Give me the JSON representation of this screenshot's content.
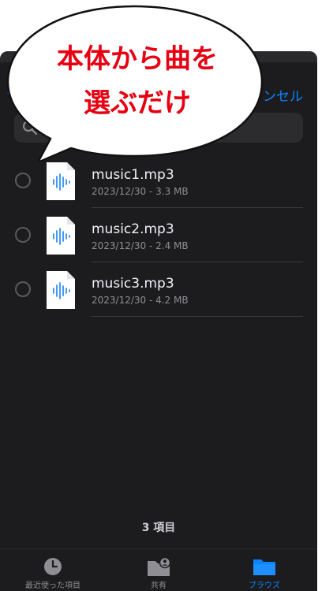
{
  "callout": {
    "line1": "本体から曲を",
    "line2": "選ぶだけ",
    "text_color": "#e60012"
  },
  "header": {
    "back_icon": "chevron-left-icon",
    "cancel_label": "ンセル"
  },
  "search": {
    "icon": "magnifying-glass-icon",
    "placeholder": ""
  },
  "files": [
    {
      "name": "music1.mp3",
      "meta": "2023/12/30 - 3.3 MB",
      "icon": "audio-file-icon"
    },
    {
      "name": "music2.mp3",
      "meta": "2023/12/30 - 2.4 MB",
      "icon": "audio-file-icon"
    },
    {
      "name": "music3.mp3",
      "meta": "2023/12/30 - 4.2 MB",
      "icon": "audio-file-icon"
    }
  ],
  "footer": {
    "item_count": "3 項目"
  },
  "tabbar": {
    "tabs": [
      {
        "label": "最近使った項目",
        "icon": "clock-icon",
        "active": false
      },
      {
        "label": "共有",
        "icon": "shared-folder-icon",
        "active": false
      },
      {
        "label": "ブラウズ",
        "icon": "folder-icon",
        "active": true
      }
    ]
  },
  "colors": {
    "accent": "#0a84ff",
    "sheet_background": "#1c1c1e",
    "callout_text": "#e60012"
  }
}
